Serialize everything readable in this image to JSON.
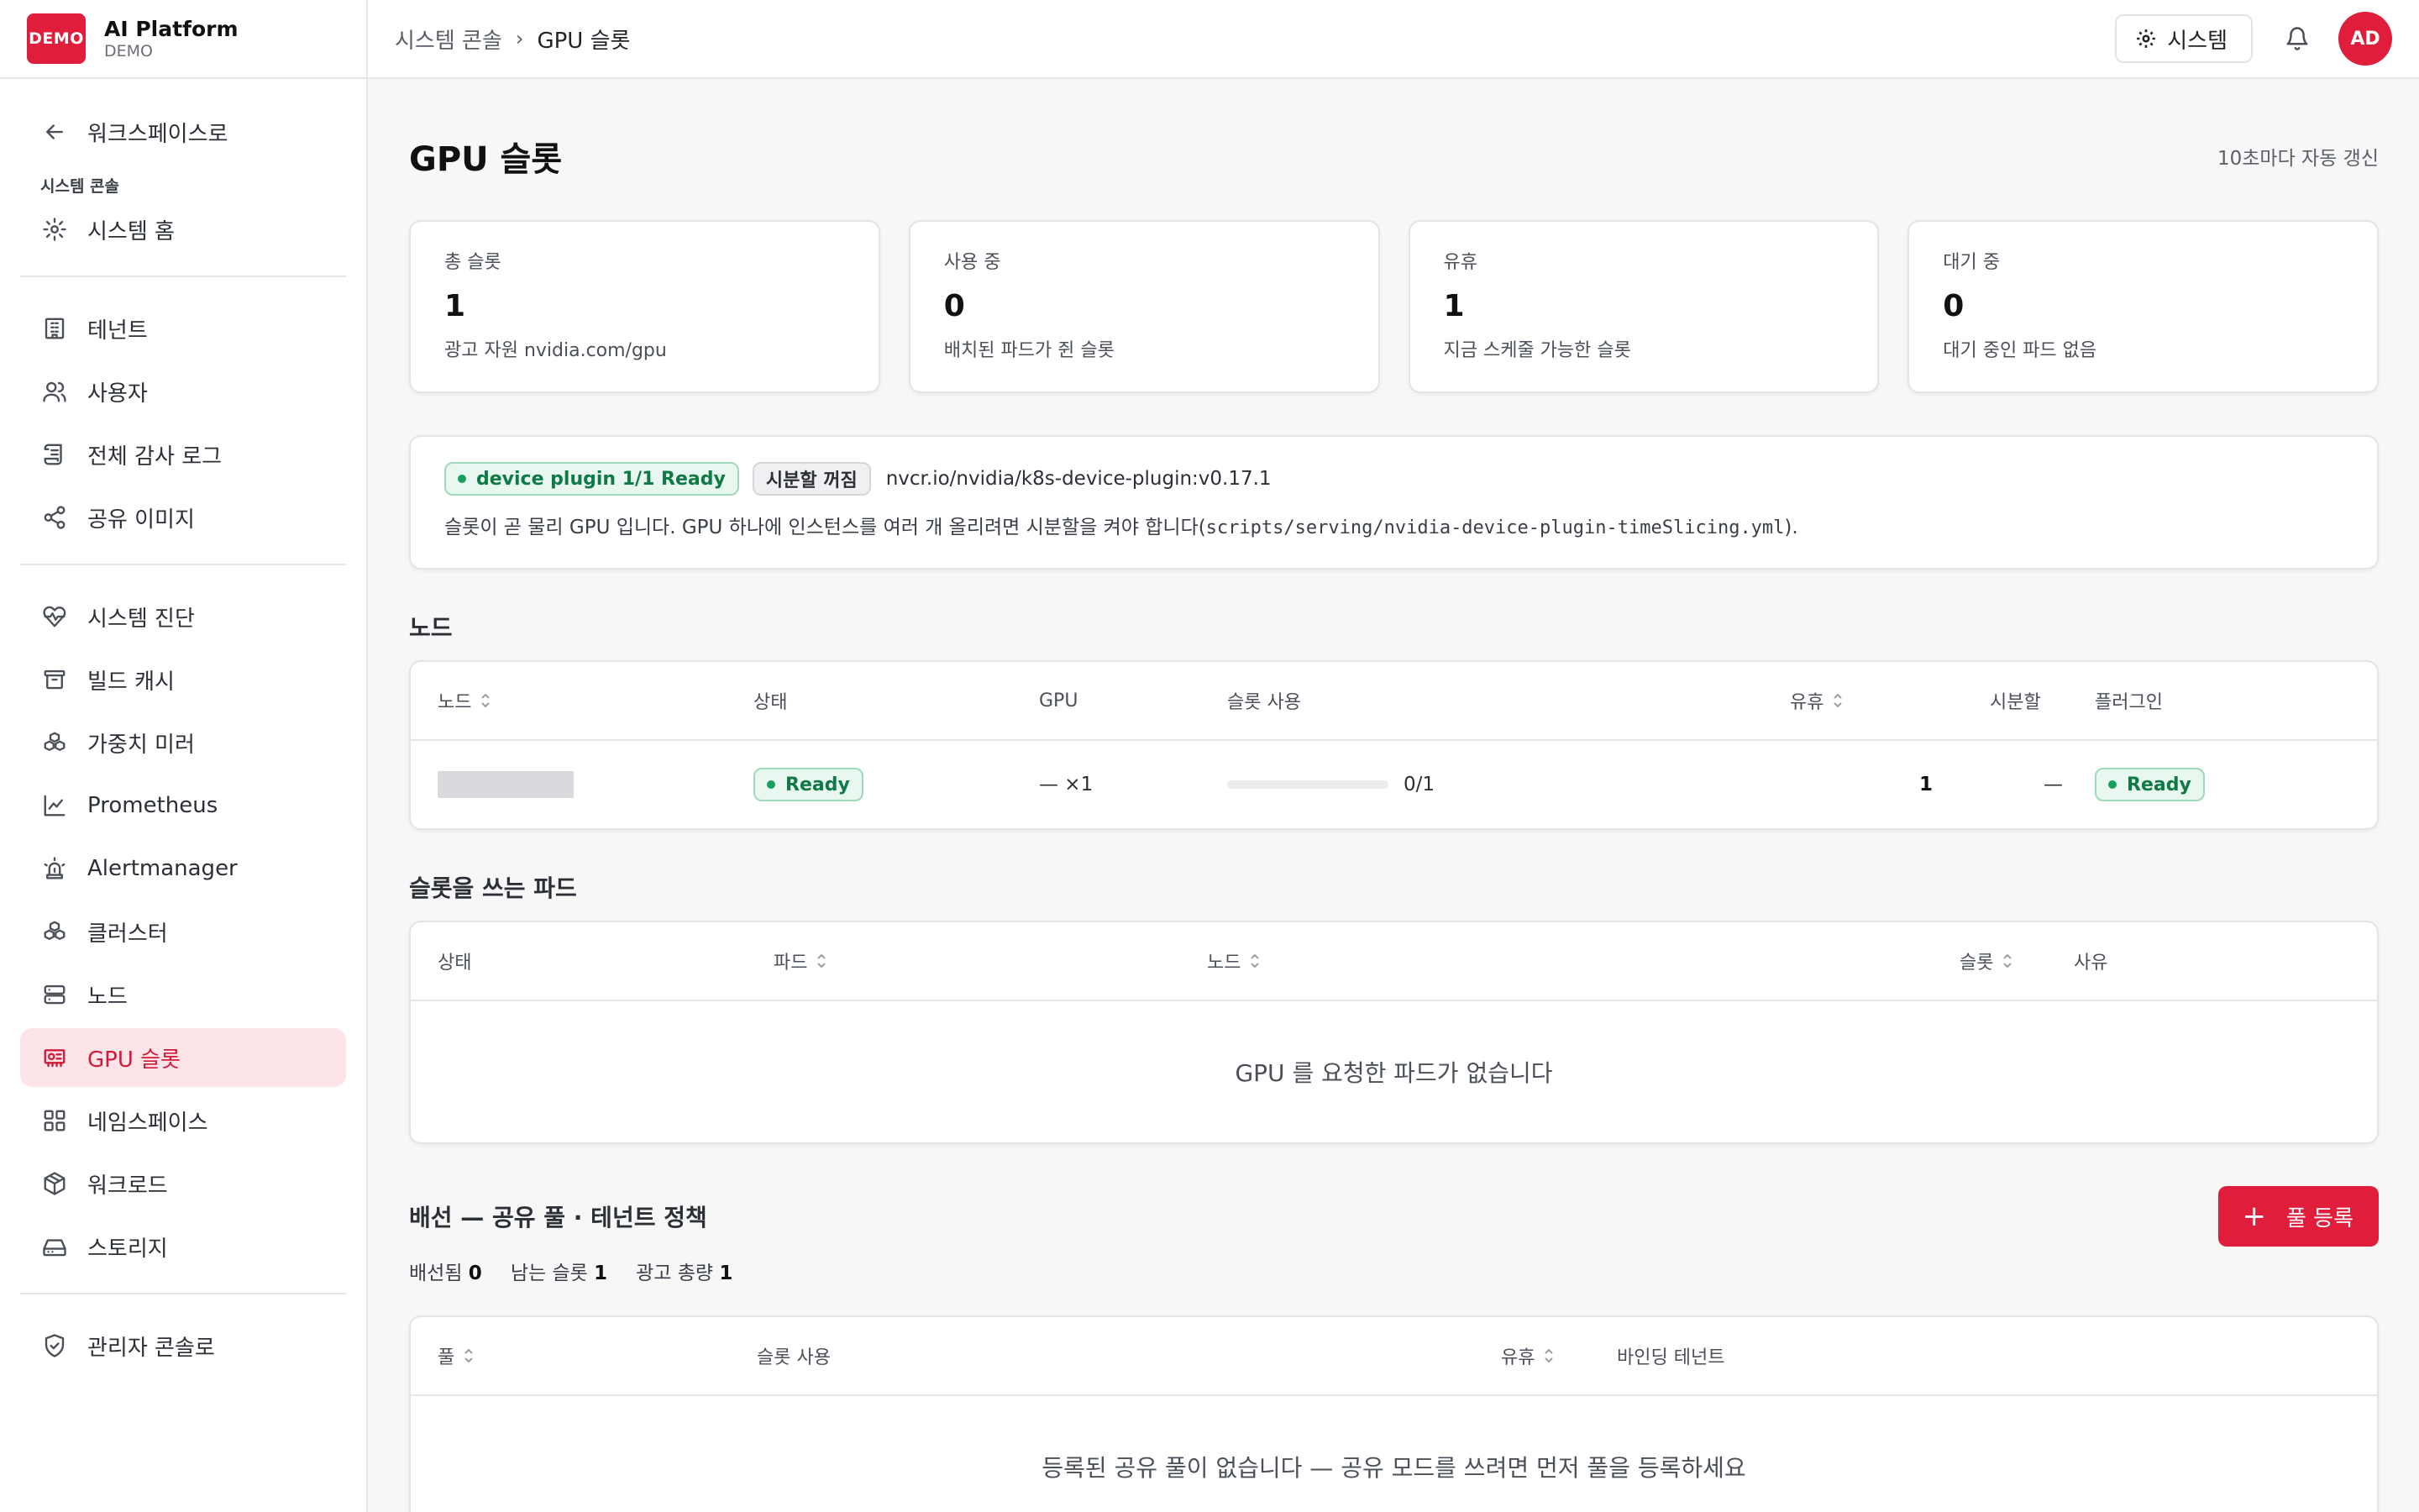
{
  "brand": {
    "logo": "DEMO",
    "title": "AI Platform",
    "subtitle": "DEMO"
  },
  "sidebar": {
    "back_label": "워크스페이스로",
    "section_label": "시스템 콘솔",
    "home_label": "시스템 홈",
    "group1": [
      {
        "label": "테넌트",
        "icon": "building-icon"
      },
      {
        "label": "사용자",
        "icon": "users-icon"
      },
      {
        "label": "전체 감사 로그",
        "icon": "scroll-icon"
      },
      {
        "label": "공유 이미지",
        "icon": "share-icon"
      }
    ],
    "group2": [
      {
        "label": "시스템 진단",
        "icon": "heart-pulse-icon"
      },
      {
        "label": "빌드 캐시",
        "icon": "archive-icon"
      },
      {
        "label": "가중치 미러",
        "icon": "boxes-icon"
      },
      {
        "label": "Prometheus",
        "icon": "line-chart-icon"
      },
      {
        "label": "Alertmanager",
        "icon": "siren-icon"
      },
      {
        "label": "클러스터",
        "icon": "boxes-icon"
      },
      {
        "label": "노드",
        "icon": "server-icon"
      },
      {
        "label": "GPU 슬롯",
        "icon": "gpu-icon",
        "active": true
      },
      {
        "label": "네임스페이스",
        "icon": "grid-icon"
      },
      {
        "label": "워크로드",
        "icon": "package-icon"
      },
      {
        "label": "스토리지",
        "icon": "hard-drive-icon"
      }
    ],
    "admin_label": "관리자 콘솔로"
  },
  "topbar": {
    "breadcrumb": [
      "시스템 콘솔",
      "GPU 슬롯"
    ],
    "system_button": "시스템",
    "avatar": "AD"
  },
  "page": {
    "title": "GPU 슬롯",
    "auto_refresh": "10초마다 자동 갱신"
  },
  "stats": [
    {
      "label": "총 슬롯",
      "value": "1",
      "hint": "광고 자원 nvidia.com/gpu"
    },
    {
      "label": "사용 중",
      "value": "0",
      "hint": "배치된 파드가 쥔 슬롯"
    },
    {
      "label": "유휴",
      "value": "1",
      "hint": "지금 스케줄 가능한 슬롯"
    },
    {
      "label": "대기 중",
      "value": "0",
      "hint": "대기 중인 파드 없음"
    }
  ],
  "plugin": {
    "status_badge": "device plugin 1/1 Ready",
    "timeslice_badge": "시분할 꺼짐",
    "image": "nvcr.io/nvidia/k8s-device-plugin:v0.17.1",
    "note_prefix": "슬롯이 곧 물리 GPU 입니다. GPU 하나에 인스턴스를 여러 개 올리려면 시분할을 켜야 합니다(",
    "note_code": "scripts/serving/nvidia-device-plugin-timeSlicing.yml",
    "note_suffix": ")."
  },
  "nodes": {
    "title": "노드",
    "headers": [
      "노드",
      "상태",
      "GPU",
      "슬롯 사용",
      "유휴",
      "시분할",
      "플러그인"
    ],
    "rows": [
      {
        "status": "Ready",
        "gpu": "— ×1",
        "slot_usage": "0/1",
        "slot_fraction": 0,
        "idle": "1",
        "timeslice": "—",
        "plugin": "Ready"
      }
    ]
  },
  "pods": {
    "title": "슬롯을 쓰는 파드",
    "headers": [
      "상태",
      "파드",
      "노드",
      "슬롯",
      "사유"
    ],
    "empty": "GPU 를 요청한 파드가 없습니다"
  },
  "pools": {
    "title": "배선 — 공유 풀 · 테넌트 정책",
    "add_button": "풀 등록",
    "stats": [
      {
        "label": "배선됨",
        "value": "0"
      },
      {
        "label": "남는 슬롯",
        "value": "1"
      },
      {
        "label": "광고 총량",
        "value": "1"
      }
    ],
    "headers": [
      "풀",
      "슬롯 사용",
      "유휴",
      "바인딩 테넌트"
    ],
    "empty": "등록된 공유 풀이 없습니다 — 공유 모드를 쓰려면 먼저 풀을 등록하세요"
  },
  "colors": {
    "accent": "#e11d3c",
    "active_bg": "#fde4e8",
    "success": "#16a05c"
  }
}
